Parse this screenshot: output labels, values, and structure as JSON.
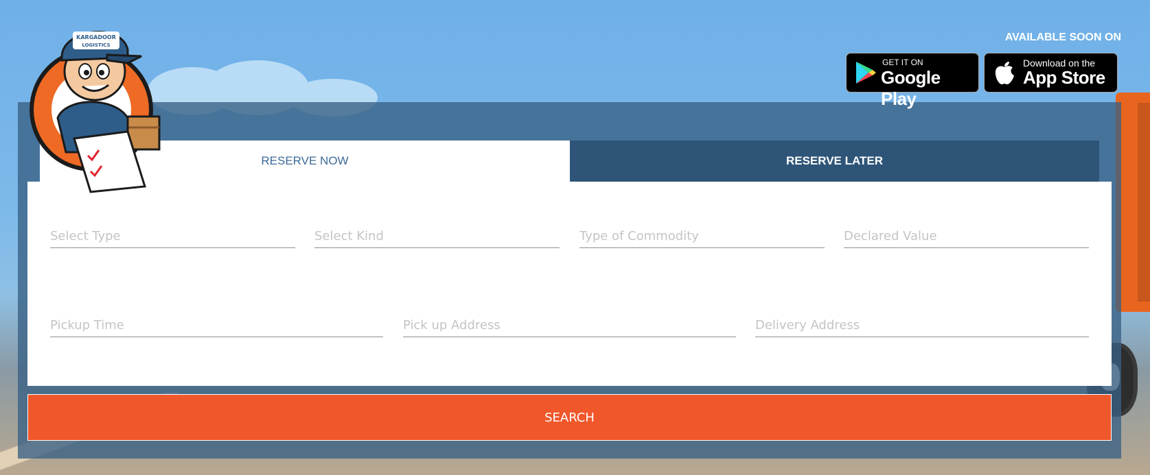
{
  "header": {
    "available_label": "AVAILABLE SOON ON",
    "google_play": {
      "small": "GET IT ON",
      "big": "Google Play"
    },
    "app_store": {
      "small": "Download on the",
      "big": "App Store"
    },
    "mascot_cap_text": [
      "KARGADOOR",
      "LOGISTICS"
    ]
  },
  "tabs": [
    {
      "label": "RESERVE NOW",
      "active": true
    },
    {
      "label": "RESERVE LATER",
      "active": false
    }
  ],
  "form": {
    "select_type": "Select Type",
    "select_kind": "Select Kind",
    "commodity": "Type of Commodity",
    "declared_value": "Declared Value",
    "pickup_time": "Pickup Time",
    "pickup_address": "Pick up Address",
    "delivery_address": "Delivery Address"
  },
  "search_label": "SEARCH",
  "colors": {
    "accent": "#f0572a",
    "tab_active_text": "#3d6a96",
    "tab_inactive_bg": "#2e5578",
    "panel_bg": "#386084"
  },
  "icons": [
    "google-play-icon",
    "apple-icon",
    "mascot-logo"
  ]
}
